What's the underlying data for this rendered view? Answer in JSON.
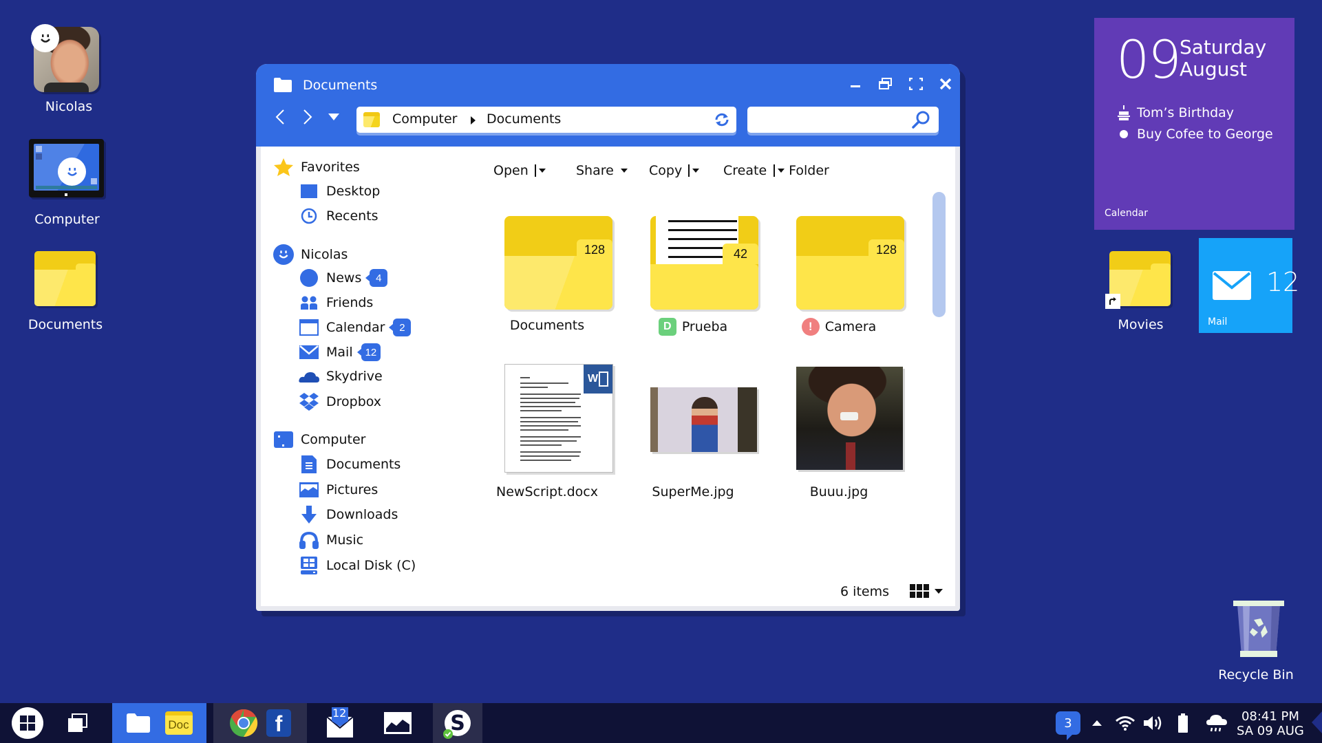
{
  "desktop": {
    "icons": [
      {
        "label": "Nicolas",
        "icon": "user-avatar"
      },
      {
        "label": "Computer",
        "icon": "computer-icon"
      },
      {
        "label": "Documents",
        "icon": "folder-icon"
      },
      {
        "label": "Movies",
        "icon": "folder-shortcut-icon"
      },
      {
        "label": "Recycle Bin",
        "icon": "recycle-bin-icon"
      }
    ]
  },
  "window": {
    "title": "Documents",
    "controls": {
      "minimize": "minimize-icon",
      "restore": "restore-icon",
      "fullscreen": "fullscreen-icon",
      "close": "close-icon"
    },
    "address": {
      "crumbs": [
        "Computer",
        "Documents"
      ]
    },
    "search": {
      "value": "",
      "placeholder": ""
    },
    "sidebar": {
      "groups": [
        {
          "label": "Favorites",
          "icon": "star-icon",
          "items": [
            {
              "label": "Desktop",
              "icon": "desktop-icon"
            },
            {
              "label": "Recents",
              "icon": "clock-icon"
            }
          ]
        },
        {
          "label": "Nicolas",
          "icon": "user-icon",
          "items": [
            {
              "label": "News",
              "icon": "news-icon",
              "badge": "4"
            },
            {
              "label": "Friends",
              "icon": "friends-icon"
            },
            {
              "label": "Calendar",
              "icon": "calendar-icon",
              "badge": "2"
            },
            {
              "label": "Mail",
              "icon": "mail-icon",
              "badge": "12"
            },
            {
              "label": "Skydrive",
              "icon": "cloud-icon"
            },
            {
              "label": "Dropbox",
              "icon": "dropbox-icon"
            }
          ]
        },
        {
          "label": "Computer",
          "icon": "computer-icon",
          "items": [
            {
              "label": "Documents",
              "icon": "document-icon"
            },
            {
              "label": "Pictures",
              "icon": "pictures-icon"
            },
            {
              "label": "Downloads",
              "icon": "download-icon"
            },
            {
              "label": "Music",
              "icon": "headphones-icon"
            },
            {
              "label": "Local Disk (C)",
              "icon": "disk-icon"
            }
          ]
        }
      ]
    },
    "toolbar": {
      "open": "Open",
      "share": "Share",
      "copy": "Copy",
      "create": "Create",
      "folder": "Folder"
    },
    "files": [
      {
        "name": "Documents",
        "type": "folder",
        "count": "128"
      },
      {
        "name": "Prueba",
        "type": "folder-with-doc",
        "count": "42",
        "status": "D"
      },
      {
        "name": "Camera",
        "type": "folder",
        "count": "128",
        "status": "!"
      },
      {
        "name": "NewScript.docx",
        "type": "word-document",
        "badge": "W"
      },
      {
        "name": "SuperMe.jpg",
        "type": "image"
      },
      {
        "name": "Buuu.jpg",
        "type": "image"
      }
    ],
    "status": {
      "count": "6 items",
      "view": "grid-view-icon"
    }
  },
  "calendar_tile": {
    "day": "09",
    "weekday": "Saturday",
    "month": "August",
    "events": [
      {
        "icon": "cake-icon",
        "text": "Tom’s Birthday"
      },
      {
        "icon": "bullet-icon",
        "text": "Buy Cofee to George"
      }
    ],
    "label": "Calendar"
  },
  "mail_tile": {
    "count": "12",
    "label": "Mail"
  },
  "taskbar": {
    "mail_badge": "12",
    "doc_label": "Doc",
    "notifications": "3",
    "time": "08:41 PM",
    "date": "SA 09 AUG"
  },
  "colors": {
    "desktop": "#1f2d88",
    "accent": "#336ce3",
    "calendar": "#613bb6",
    "mail": "#16a3f9",
    "taskbar": "#0f1236",
    "folder": "#fee54a"
  }
}
